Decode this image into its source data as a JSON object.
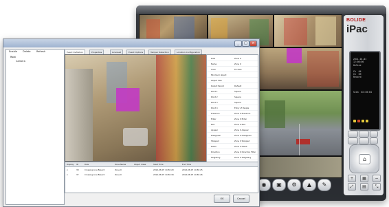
{
  "ipac": {
    "brand_logo": "BOLIDE",
    "product_name": "iPac",
    "lcd_lines": "2011-01-01\n12:00:00\nOnline\n\nCh  04\nCh  09\nRecord\n\n\n\n\nScan  02:30:04",
    "toolbar_icons": [
      "record-icon",
      "camera-icon",
      "settings-icon",
      "alarm-icon",
      "tools-icon"
    ]
  },
  "config_window": {
    "title": "",
    "toolbar": [
      "Enable",
      "Delete",
      "Refresh"
    ],
    "tree": [
      "Root",
      "Camera"
    ],
    "tabs": [
      "Event Definition",
      "Properties",
      "Licensed",
      "Event Options",
      "Tamper Detection",
      "Location Configuration"
    ],
    "properties": [
      {
        "k": "Rule",
        "v": "Zone 0"
      },
      {
        "k": "Name",
        "v": "Zone 0"
      },
      {
        "k": "Color",
        "v": "Fuchsia"
      },
      {
        "k": "Minimum object",
        "v": ""
      },
      {
        "k": "Object Size",
        "v": ""
      },
      {
        "k": "Detect Period",
        "v": "Default"
      },
      {
        "k": "Point 1",
        "v": "Square"
      },
      {
        "k": "Point 2",
        "v": "Square"
      },
      {
        "k": "Point 3",
        "v": "Square"
      },
      {
        "k": "Point 4",
        "v": "Entry of People"
      },
      {
        "k": "Presence",
        "v": "Zone 0 Presence"
      },
      {
        "k": "Enter",
        "v": "Zone 0 Enter"
      },
      {
        "k": "Exit",
        "v": "Zone 0 Exit"
      },
      {
        "k": "Appear",
        "v": "Zone 0 Appear"
      },
      {
        "k": "Disappear",
        "v": "Zone 0 Disappear"
      },
      {
        "k": "Stopped",
        "v": "Zone 0 Stopped"
      },
      {
        "k": "Dwell",
        "v": "Zone 0 Dwell"
      },
      {
        "k": "Direction",
        "v": "Zone 0 Direction Filter"
      },
      {
        "k": "Tailgating",
        "v": "Zone 0 Tailgating"
      }
    ],
    "events_header": [
      "Display",
      "ID",
      "Rule",
      "Zone Name",
      "Object Class",
      "Start Time",
      "End Time"
    ],
    "events": [
      [
        "x",
        "39",
        "Crossing Line Breach",
        "Zone 0",
        "",
        "2012-08-07 14:50:20",
        "2012-08-07 14:50:25"
      ],
      [
        "x",
        "37",
        "Crossing Line Breach",
        "Zone 0",
        "",
        "2012-08-07 14:50:18",
        "2012-08-07 14:50:26"
      ]
    ],
    "footer_buttons": [
      "OK",
      "Cancel"
    ]
  }
}
